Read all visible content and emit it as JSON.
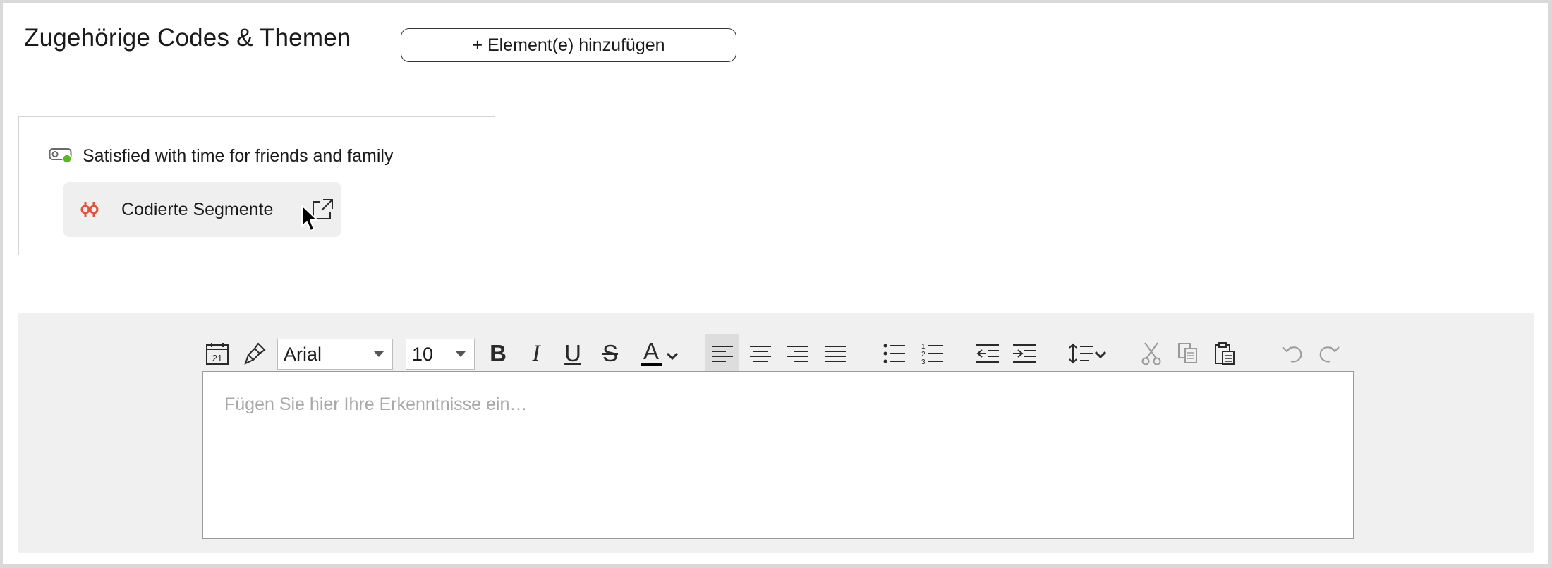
{
  "header": {
    "title": "Zugehörige Codes & Themen",
    "add_button_label": "+ Element(e) hinzufügen"
  },
  "code": {
    "name": "Satisfied with time for friends and family",
    "icon": "code-toggle-icon",
    "status_color": "#5ab52a"
  },
  "segments": {
    "label": "Codierte Segmente",
    "icon": "coded-segments-icon",
    "icon_color": "#e0523a",
    "open_icon": "open-external-icon"
  },
  "toolbar": {
    "font_family": "Arial",
    "font_size": "10",
    "bold": "B",
    "italic": "I",
    "underline": "U",
    "strikethrough": "S",
    "font_color_letter": "A",
    "font_color": "#000000",
    "active_alignment": "left"
  },
  "editor": {
    "placeholder": "Fügen Sie hier Ihre Erkenntnisse ein…"
  },
  "date_icon_number": "21"
}
